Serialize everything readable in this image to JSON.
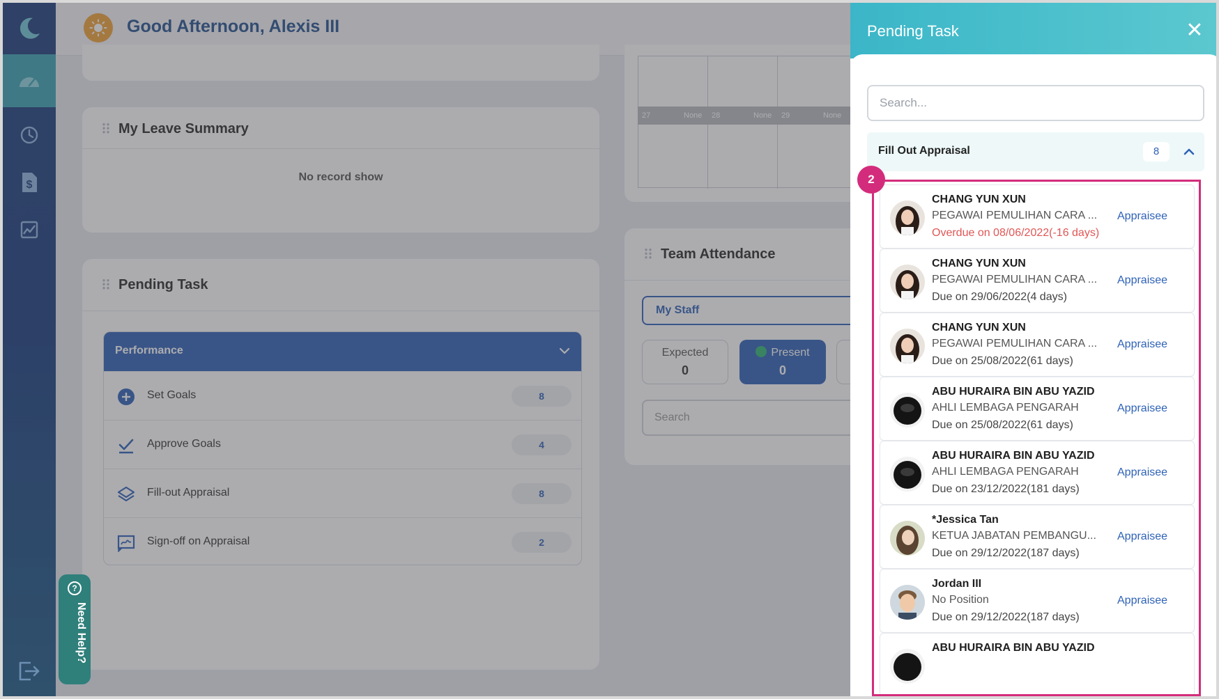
{
  "header": {
    "greeting": "Good Afternoon, Alexis III"
  },
  "sidebar": {
    "items": [
      {
        "icon": "dashboard-icon",
        "active": true
      },
      {
        "icon": "history-icon"
      },
      {
        "icon": "payslip-icon"
      },
      {
        "icon": "chart-icon"
      }
    ],
    "logout_icon": "logout-icon"
  },
  "leave_summary": {
    "title": "My Leave Summary",
    "empty_text": "No record show"
  },
  "pending_task_card": {
    "title": "Pending Task",
    "group_label": "Performance",
    "rows": [
      {
        "icon": "plus-circle-icon",
        "label": "Set Goals",
        "count": "8"
      },
      {
        "icon": "check-icon",
        "label": "Approve Goals",
        "count": "4"
      },
      {
        "icon": "layers-icon",
        "label": "Fill-out Appraisal",
        "count": "8"
      },
      {
        "icon": "signature-icon",
        "label": "Sign-off on Appraisal",
        "count": "2"
      }
    ]
  },
  "calendar": {
    "days": [
      {
        "day": "27",
        "value": "None"
      },
      {
        "day": "28",
        "value": "None"
      },
      {
        "day": "29",
        "value": "None"
      }
    ]
  },
  "team_attendance": {
    "title": "Team Attendance",
    "filter_label": "My Staff",
    "expected_label": "Expected",
    "expected_value": "0",
    "present_label": "Present",
    "present_value": "0",
    "search_placeholder": "Search"
  },
  "help": {
    "label": "Need Help?"
  },
  "panel": {
    "title": "Pending Task",
    "close": "✕",
    "search_placeholder": "Search...",
    "section_label": "Fill Out Appraisal",
    "section_count": "8",
    "step_badge": "2",
    "tasks": [
      {
        "name": "CHANG YUN XUN",
        "position": "PEGAWAI PEMULIHAN CARA ...",
        "due": "Overdue on 08/06/2022(-16 days)",
        "overdue": true,
        "link": "Appraisee"
      },
      {
        "name": "CHANG YUN XUN",
        "position": "PEGAWAI PEMULIHAN CARA ...",
        "due": "Due on 29/06/2022(4 days)",
        "link": "Appraisee"
      },
      {
        "name": "CHANG YUN XUN",
        "position": "PEGAWAI PEMULIHAN CARA ...",
        "due": "Due on 25/08/2022(61 days)",
        "link": "Appraisee"
      },
      {
        "name": "ABU HURAIRA BIN ABU YAZID",
        "position": "AHLI LEMBAGA PENGARAH",
        "due": "Due on 25/08/2022(61 days)",
        "link": "Appraisee"
      },
      {
        "name": "ABU HURAIRA BIN ABU YAZID",
        "position": "AHLI LEMBAGA PENGARAH",
        "due": "Due on 23/12/2022(181 days)",
        "link": "Appraisee"
      },
      {
        "name": "*Jessica Tan",
        "position": "KETUA JABATAN PEMBANGU...",
        "due": "Due on 29/12/2022(187 days)",
        "link": "Appraisee"
      },
      {
        "name": "Jordan III",
        "position": "No Position",
        "due": "Due on 29/12/2022(187 days)",
        "link": "Appraisee"
      },
      {
        "name": "ABU HURAIRA BIN ABU YAZID",
        "position": "",
        "due": "",
        "link": ""
      }
    ]
  },
  "colors": {
    "primary": "#2f62b7",
    "teal": "#3aa3b4",
    "highlight": "#d42c7c",
    "overdue": "#e05656"
  }
}
